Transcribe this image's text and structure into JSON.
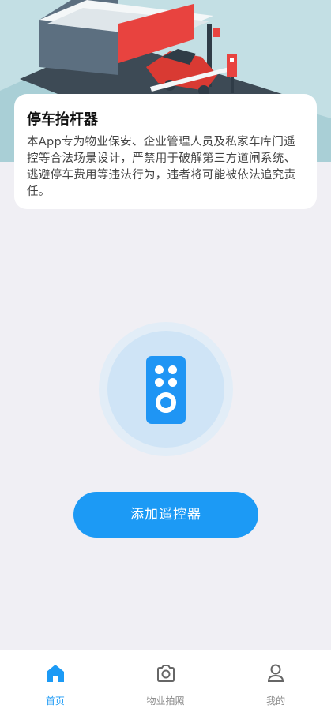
{
  "card": {
    "title": "停车抬杆器",
    "text": "本App专为物业保安、企业管理人员及私家车库门遥控等合法场景设计，严禁用于破解第三方道闸系统、逃避停车费用等违法行为，违者将可能被依法追究责任。"
  },
  "main": {
    "add_button_label": "添加遥控器",
    "remote_icon": "remote-control-icon"
  },
  "tabs": [
    {
      "label": "首页",
      "icon": "home-icon",
      "active": true
    },
    {
      "label": "物业拍照",
      "icon": "camera-icon",
      "active": false
    },
    {
      "label": "我的",
      "icon": "user-icon",
      "active": false
    }
  ],
  "colors": {
    "accent": "#1c9af5",
    "hero_background": "#c3dfe4",
    "page_background": "#f0eff4"
  }
}
